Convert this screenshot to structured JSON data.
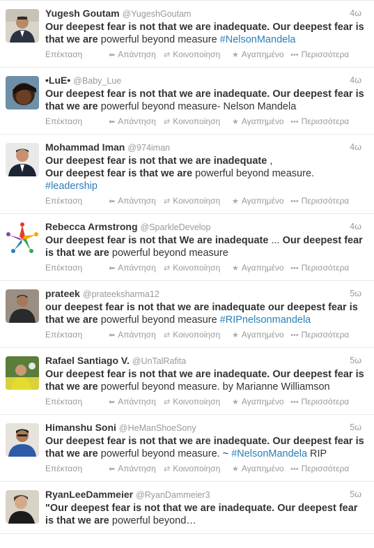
{
  "actions": {
    "expand": "Επέκταση",
    "reply": "Απάντηση",
    "retweet": "Κοινοποίηση",
    "favorite": "Αγαπημένο",
    "more": "Περισσότερα"
  },
  "tweets": [
    {
      "name": "Yugesh Goutam",
      "handle": "@YugeshGoutam",
      "time": "4ω",
      "parts": [
        {
          "b": "Our deepest fear is not that we are inadequate. Our deepest fear is that we are"
        },
        {
          "t": " powerful beyond measure "
        },
        {
          "h": "#NelsonMandela"
        }
      ]
    },
    {
      "name": "•LuE•",
      "handle": "@Baby_Lue",
      "time": "4ω",
      "parts": [
        {
          "b": "Our deepest fear is not that we are inadequate. Our deepest fear is that we are"
        },
        {
          "t": " powerful beyond measure- Nelson Mandela"
        }
      ]
    },
    {
      "name": "Mohammad Iman",
      "handle": "@974iman",
      "time": "4ω",
      "parts": [
        {
          "b": "Our deepest fear is not that we are inadequate"
        },
        {
          "t": " ,"
        },
        {
          "br": true
        },
        {
          "b": "Our deepest fear is that we are"
        },
        {
          "t": " powerful beyond measure."
        },
        {
          "br": true
        },
        {
          "h": "#leadership"
        }
      ]
    },
    {
      "name": "Rebecca Armstrong",
      "handle": "@SparkleDevelop",
      "time": "4ω",
      "parts": [
        {
          "b": "Our deepest fear is not that We are inadequate"
        },
        {
          "t": " ... "
        },
        {
          "b": "Our deepest fear is that we are"
        },
        {
          "t": " powerful beyond measure"
        }
      ]
    },
    {
      "name": "prateek",
      "handle": "@prateeksharma12",
      "time": "5ω",
      "parts": [
        {
          "b": "our deepest fear is not that we are inadequate our deepest fear is that we are"
        },
        {
          "t": " powerful beyond measure "
        },
        {
          "h": "#RIPnelsonmandela"
        }
      ]
    },
    {
      "name": "Rafael Santiago V.",
      "handle": "@UnTalRafita",
      "time": "5ω",
      "parts": [
        {
          "b": "Our deepest fear is not that we are inadequate. Our deepest fear is that we are"
        },
        {
          "t": " powerful beyond measure.  by Marianne Williamson"
        }
      ]
    },
    {
      "name": "Himanshu Soni",
      "handle": "@HeManShoeSony",
      "time": "5ω",
      "parts": [
        {
          "b": "Our deepest fear is not that we are inadequate. Our deepest fear is that we are"
        },
        {
          "t": " powerful beyond measure. ~ "
        },
        {
          "h": "#NelsonMandela"
        },
        {
          "t": " RIP"
        }
      ]
    },
    {
      "name": "RyanLeeDammeier",
      "handle": "@RyanDammeier3",
      "time": "5ω",
      "parts": [
        {
          "b": "\"Our deepest fear is not that we are inadequate. Our deepest fear is that we are"
        },
        {
          "t": " powerful beyond…"
        }
      ]
    }
  ]
}
